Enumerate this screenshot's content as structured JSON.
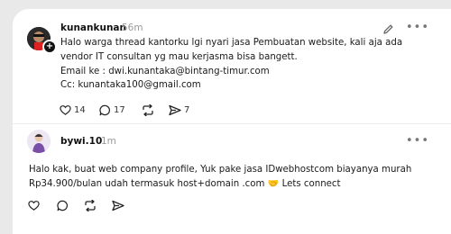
{
  "posts": [
    {
      "username": "kunankunan",
      "time": "56m",
      "text": "Halo warga thread kantorku lgi nyari jasa Pembuatan website, kali aja ada\nvendor IT consultan yg mau kerjasma bisa bangett.\nEmail ke : dwi.kunantaka@bintang-timur.com\nCc: kunantaka100@gmail.com",
      "likes": "14",
      "replies": "17",
      "reposts": "",
      "shares": "7"
    },
    {
      "username": "bywi.10",
      "time": "1m",
      "text": "Halo kak, buat web company profile, Yuk pake jasa IDwebhostcom biayanya murah\nRp34.900/bulan udah termasuk host+domain .com 🤝 Lets connect"
    }
  ],
  "icons": [
    "edit-icon",
    "more-icon",
    "heart-icon",
    "comment-icon",
    "repost-icon",
    "share-icon"
  ]
}
